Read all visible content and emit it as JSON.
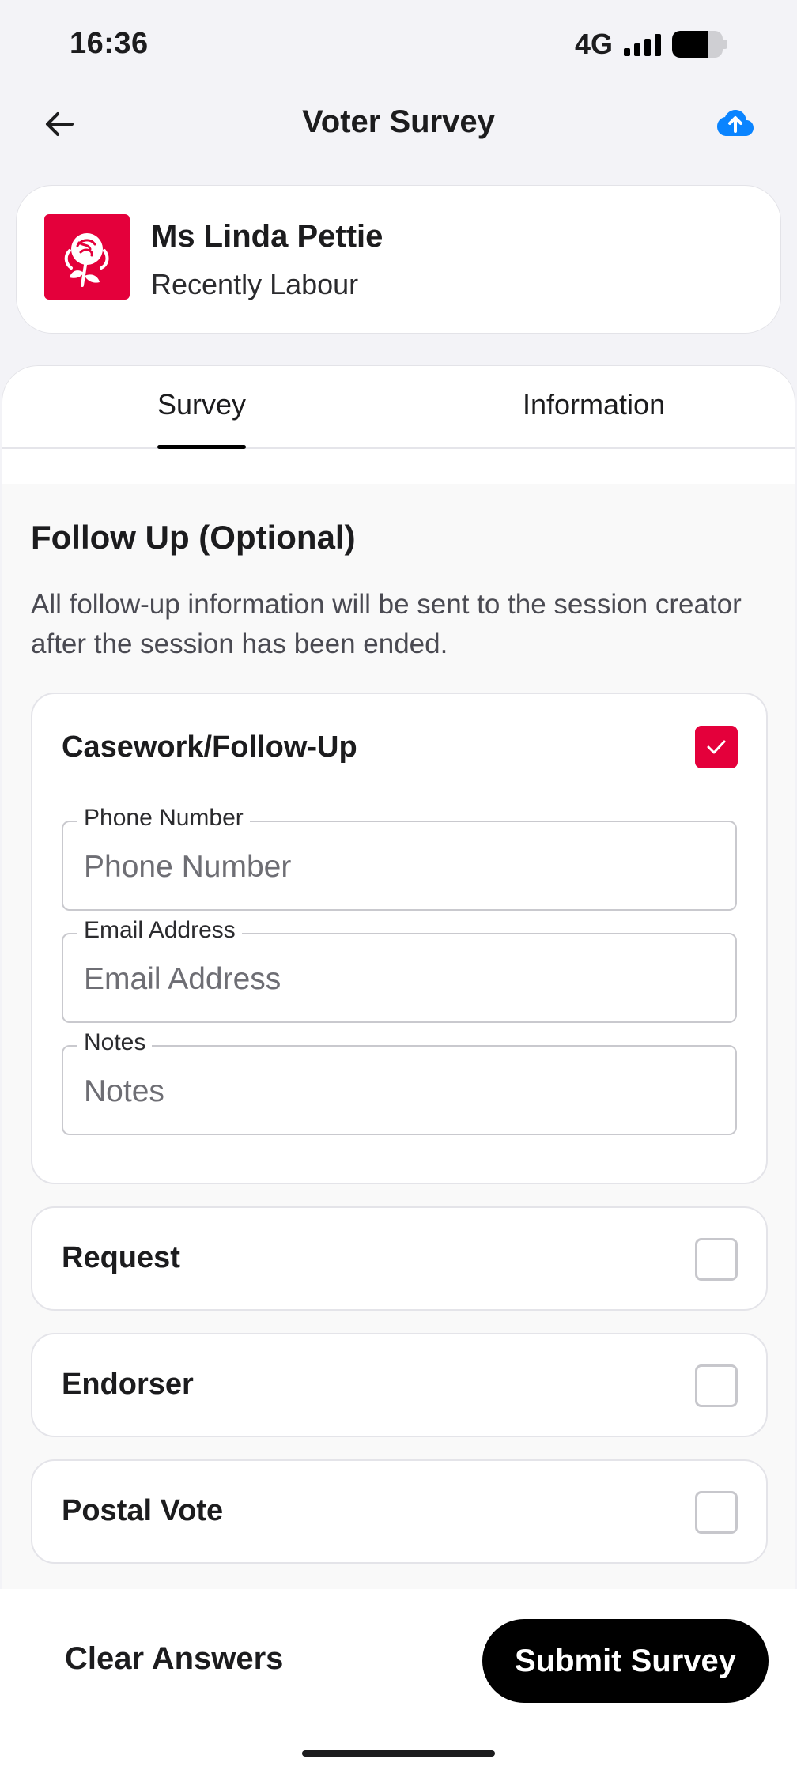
{
  "status_bar": {
    "time": "16:36",
    "network": "4G",
    "battery_level": 0.7
  },
  "header": {
    "title": "Voter Survey",
    "back_icon": "arrow-left-icon",
    "upload_icon": "cloud-upload-icon"
  },
  "voter": {
    "name": "Ms Linda Pettie",
    "affiliation": "Recently Labour",
    "party_color": "#e4003b"
  },
  "tabs": [
    {
      "label": "Survey",
      "active": true
    },
    {
      "label": "Information",
      "active": false
    }
  ],
  "follow_up": {
    "title": "Follow Up (Optional)",
    "description": "All follow-up information will be sent to the session creator after the session has been ended.",
    "casework": {
      "label": "Casework/Follow-Up",
      "checked": true,
      "fields": [
        {
          "label": "Phone Number",
          "placeholder": "Phone Number",
          "value": ""
        },
        {
          "label": "Email Address",
          "placeholder": "Email Address",
          "value": ""
        },
        {
          "label": "Notes",
          "placeholder": "Notes",
          "value": ""
        }
      ]
    },
    "options": [
      {
        "label": "Request",
        "checked": false
      },
      {
        "label": "Endorser",
        "checked": false
      },
      {
        "label": "Postal Vote",
        "checked": false
      }
    ]
  },
  "actions": {
    "clear_label": "Clear Answers",
    "submit_label": "Submit Survey"
  },
  "colors": {
    "accent": "#e4003b",
    "upload_icon": "#0a84ff"
  }
}
